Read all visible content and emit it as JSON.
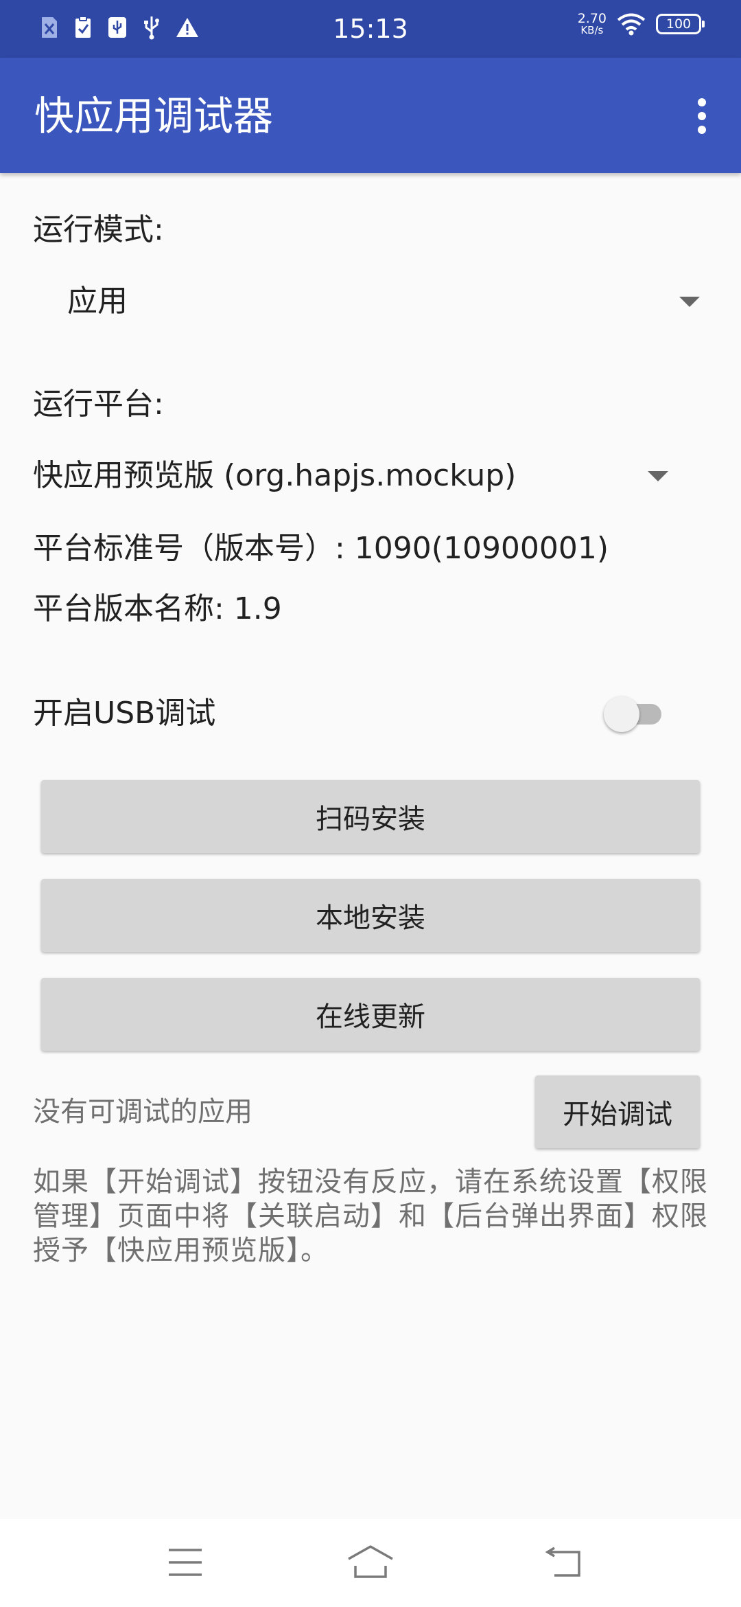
{
  "status_bar": {
    "time": "15:13",
    "net_speed_value": "2.70",
    "net_speed_unit": "KB/s",
    "battery_level": "100",
    "icons": [
      "sim-blocked-icon",
      "clipboard-check-icon",
      "usb-debug-icon",
      "usb-icon",
      "warning-icon",
      "wifi-icon",
      "battery-icon"
    ]
  },
  "app_bar": {
    "title": "快应用调试器",
    "menu_icon": "more-vert-icon"
  },
  "run_mode": {
    "label": "运行模式:",
    "selected": "应用"
  },
  "run_platform": {
    "label": "运行平台:",
    "selected": "快应用预览版 (org.hapjs.mockup)",
    "standard_version": "平台标准号（版本号）: 1090(10900001)",
    "version_name": "平台版本名称: 1.9"
  },
  "usb_debug": {
    "label": "开启USB调试",
    "enabled": false
  },
  "buttons": {
    "scan_install": "扫码安装",
    "local_install": "本地安装",
    "online_update": "在线更新",
    "start_debug": "开始调试"
  },
  "debug_status": "没有可调试的应用",
  "hint": "如果【开始调试】按钮没有反应，请在系统设置【权限管理】页面中将【关联启动】和【后台弹出界面】权限授予【快应用预览版】。",
  "nav_bar": {
    "icons": [
      "menu-icon",
      "home-icon",
      "back-icon"
    ]
  },
  "colors": {
    "status_bar": "#2f48a6",
    "app_bar": "#3b56bd",
    "background": "#fafafa",
    "button": "#d6d6d6"
  }
}
